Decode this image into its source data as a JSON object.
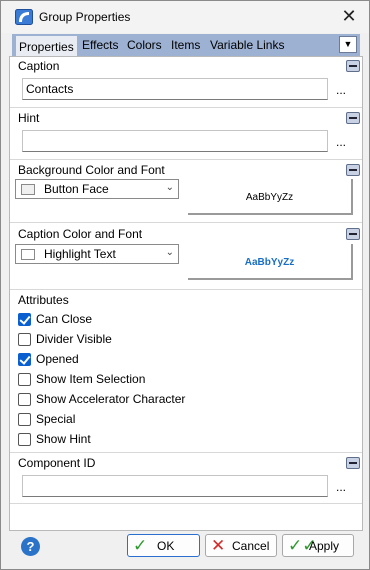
{
  "window": {
    "title": "Group Properties",
    "icon": "app-icon",
    "close_glyph": "✕"
  },
  "tabs": [
    {
      "label": "Properties",
      "active": true
    },
    {
      "label": "Effects",
      "active": false
    },
    {
      "label": "Colors",
      "active": false
    },
    {
      "label": "Items",
      "active": false
    },
    {
      "label": "Variable Links",
      "active": false
    }
  ],
  "tab_dropdown_glyph": "▼",
  "caption": {
    "label": "Caption",
    "value": "Contacts",
    "ellipsis": "..."
  },
  "hint": {
    "label": "Hint",
    "value": "",
    "ellipsis": "..."
  },
  "background": {
    "label": "Background Color and Font",
    "color_name": "Button Face",
    "swatch_color": "#f0f0f0",
    "preview_text": "AaBbYyZz",
    "preview_color": "#000000"
  },
  "caption_color": {
    "label": "Caption Color and Font",
    "color_name": "Highlight Text",
    "swatch_color": "#ffffff",
    "preview_text": "AaBbYyZz",
    "preview_color": "#1a6fc4"
  },
  "attributes": {
    "label": "Attributes",
    "items": [
      {
        "label": "Can Close",
        "checked": true
      },
      {
        "label": "Divider Visible",
        "checked": false
      },
      {
        "label": "Opened",
        "checked": true
      },
      {
        "label": "Show Item Selection",
        "checked": false
      },
      {
        "label": "Show Accelerator Character",
        "checked": false
      },
      {
        "label": "Special",
        "checked": false
      },
      {
        "label": "Show Hint",
        "checked": false
      }
    ]
  },
  "component_id": {
    "label": "Component ID",
    "value": "",
    "ellipsis": "..."
  },
  "footer": {
    "help_glyph": "?",
    "ok_label": "OK",
    "cancel_label": "Cancel",
    "apply_label": "Apply"
  },
  "colors": {
    "tab_strip": "#9db1d3",
    "checkbox_checked": "#0a5fd0",
    "ok_icon": "#2e9a2e",
    "cancel_icon": "#d42a2a"
  }
}
